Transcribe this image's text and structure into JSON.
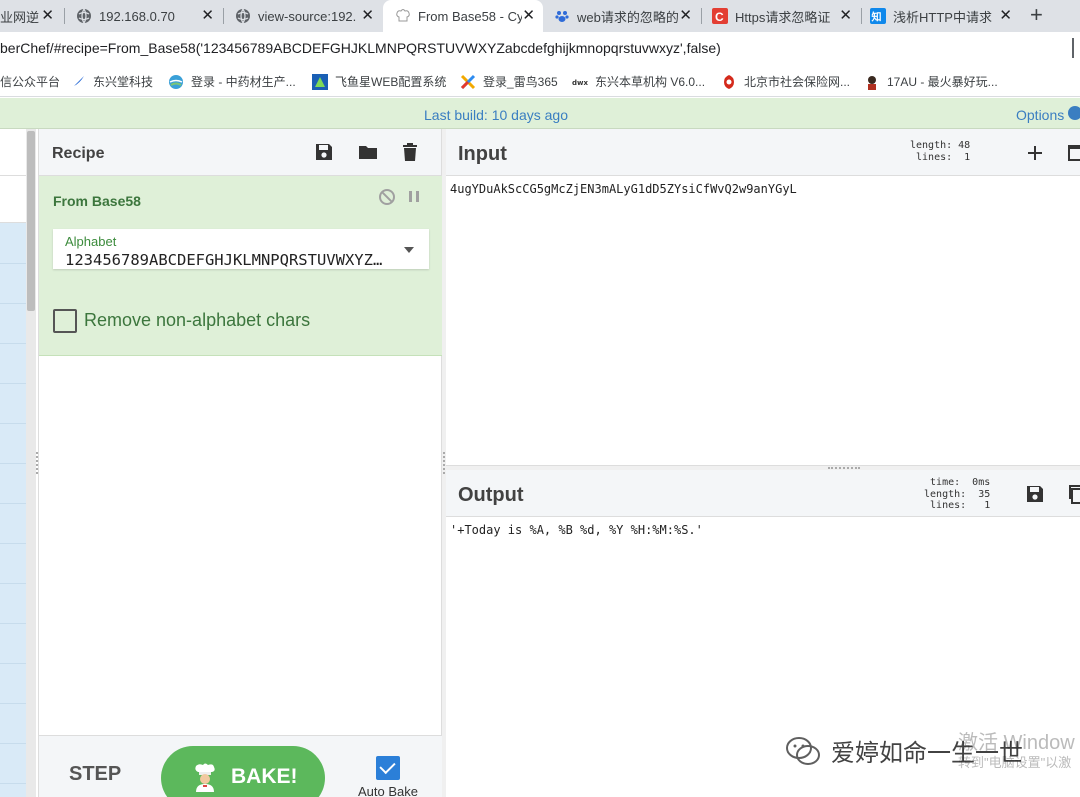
{
  "browser": {
    "tabs": [
      {
        "title": "业网逆",
        "active": false
      },
      {
        "title": "192.168.0.70",
        "active": false
      },
      {
        "title": "view-source:192.",
        "active": false
      },
      {
        "title": "From Base58 - Cy",
        "active": true
      },
      {
        "title": "web请求的忽略的",
        "active": false
      },
      {
        "title": "Https请求忽略证",
        "active": false
      },
      {
        "title": "浅析HTTP中请求",
        "active": false
      }
    ],
    "close_glyph": "✕",
    "new_tab_glyph": "+",
    "url": "berChef/#recipe=From_Base58('123456789ABCDEFGHJKLMNPQRSTUVWXYZabcdefghijkmnopqrstuvwxyz',false)",
    "bookmarks": [
      {
        "label": "信公众平台",
        "icon": "none"
      },
      {
        "label": "东兴堂科技",
        "icon": "feather-icon"
      },
      {
        "label": "登录 - 中药材生产...",
        "icon": "globe-icon"
      },
      {
        "label": "飞鱼星WEB配置系统",
        "icon": "router-icon"
      },
      {
        "label": "登录_雷鸟365",
        "icon": "x-icon"
      },
      {
        "label": "东兴本草机构 V6.0...",
        "icon": "dwx-icon"
      },
      {
        "label": "北京市社会保险网...",
        "icon": "shield-icon"
      },
      {
        "label": "17AU - 最火暴好玩...",
        "icon": "avatar-icon"
      }
    ]
  },
  "banner": {
    "last_build": "Last build: 10 days ago",
    "options": "Options"
  },
  "recipe": {
    "title": "Recipe",
    "operation": {
      "name": "From Base58",
      "alphabet_label": "Alphabet",
      "alphabet_value": "123456789ABCDEFGHJKLMNPQRSTUVWXYZabcdefghijkmnopqrstuvwxyz",
      "remove_label": "Remove non-alphabet chars",
      "remove_checked": false
    },
    "step_label": "STEP",
    "bake_label": "BAKE!",
    "autobake_label": "Auto Bake",
    "autobake_checked": true
  },
  "input": {
    "title": "Input",
    "stats": "length: 48\n lines:  1",
    "text": "4ugYDuAkScCG5gMcZjEN3mALyG1dD5ZYsiCfWvQ2w9anYGyL"
  },
  "output": {
    "title": "Output",
    "stats": "  time:  0ms\nlength:  35\n lines:   1",
    "text": "'+Today is %A, %B %d, %Y %H:%M:%S.'"
  },
  "watermark": {
    "brand": "爱婷如命一生一世",
    "windows": "激活 Window",
    "windows_sub": "转到\"电脑设置\"以激"
  },
  "colors": {
    "accent_green": "#5cb85c",
    "op_green": "#dff0d8",
    "link_blue": "#3a7ec1"
  }
}
